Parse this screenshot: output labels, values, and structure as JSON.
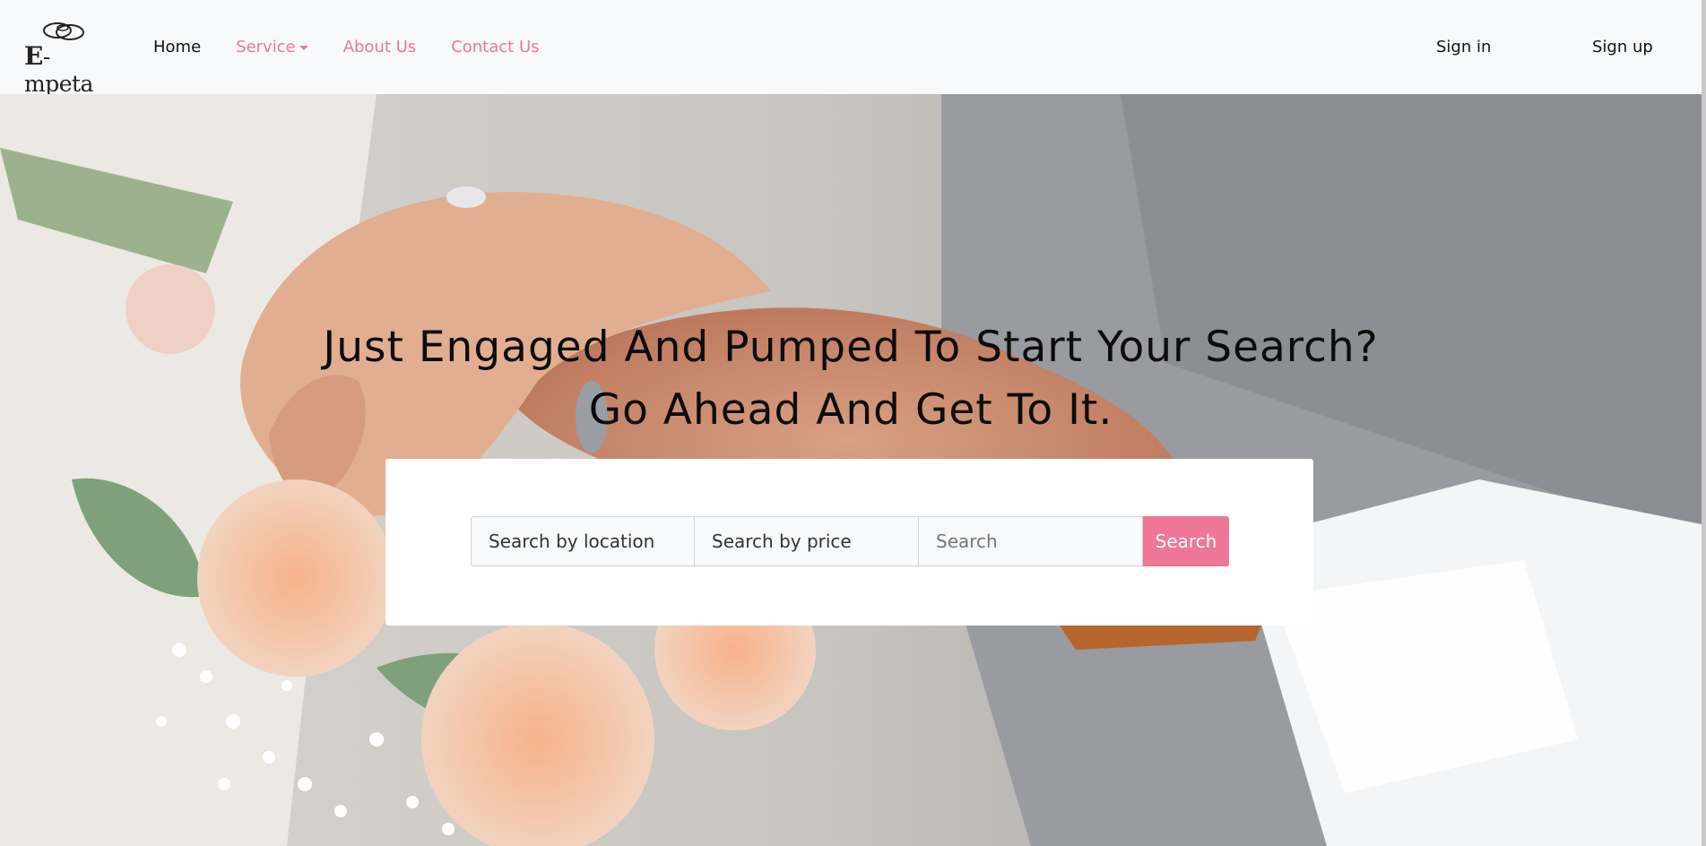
{
  "brand": {
    "logo_text_initial": "E",
    "logo_text_rest": "-mpeta"
  },
  "nav": {
    "home": "Home",
    "service": "Service",
    "about": "About Us",
    "contact": "Contact Us",
    "signin": "Sign in",
    "signup": "Sign up"
  },
  "hero": {
    "headline_line1": "Just Engaged And Pumped To Start Your Search?",
    "headline_line2": "Go Ahead And Get To It."
  },
  "search": {
    "location_label": "Search by location",
    "price_label": "Search by price",
    "query_placeholder": "Search",
    "button_label": "Search"
  },
  "colors": {
    "accent": "#ef7696",
    "navbar_bg": "#f8f9fa"
  }
}
